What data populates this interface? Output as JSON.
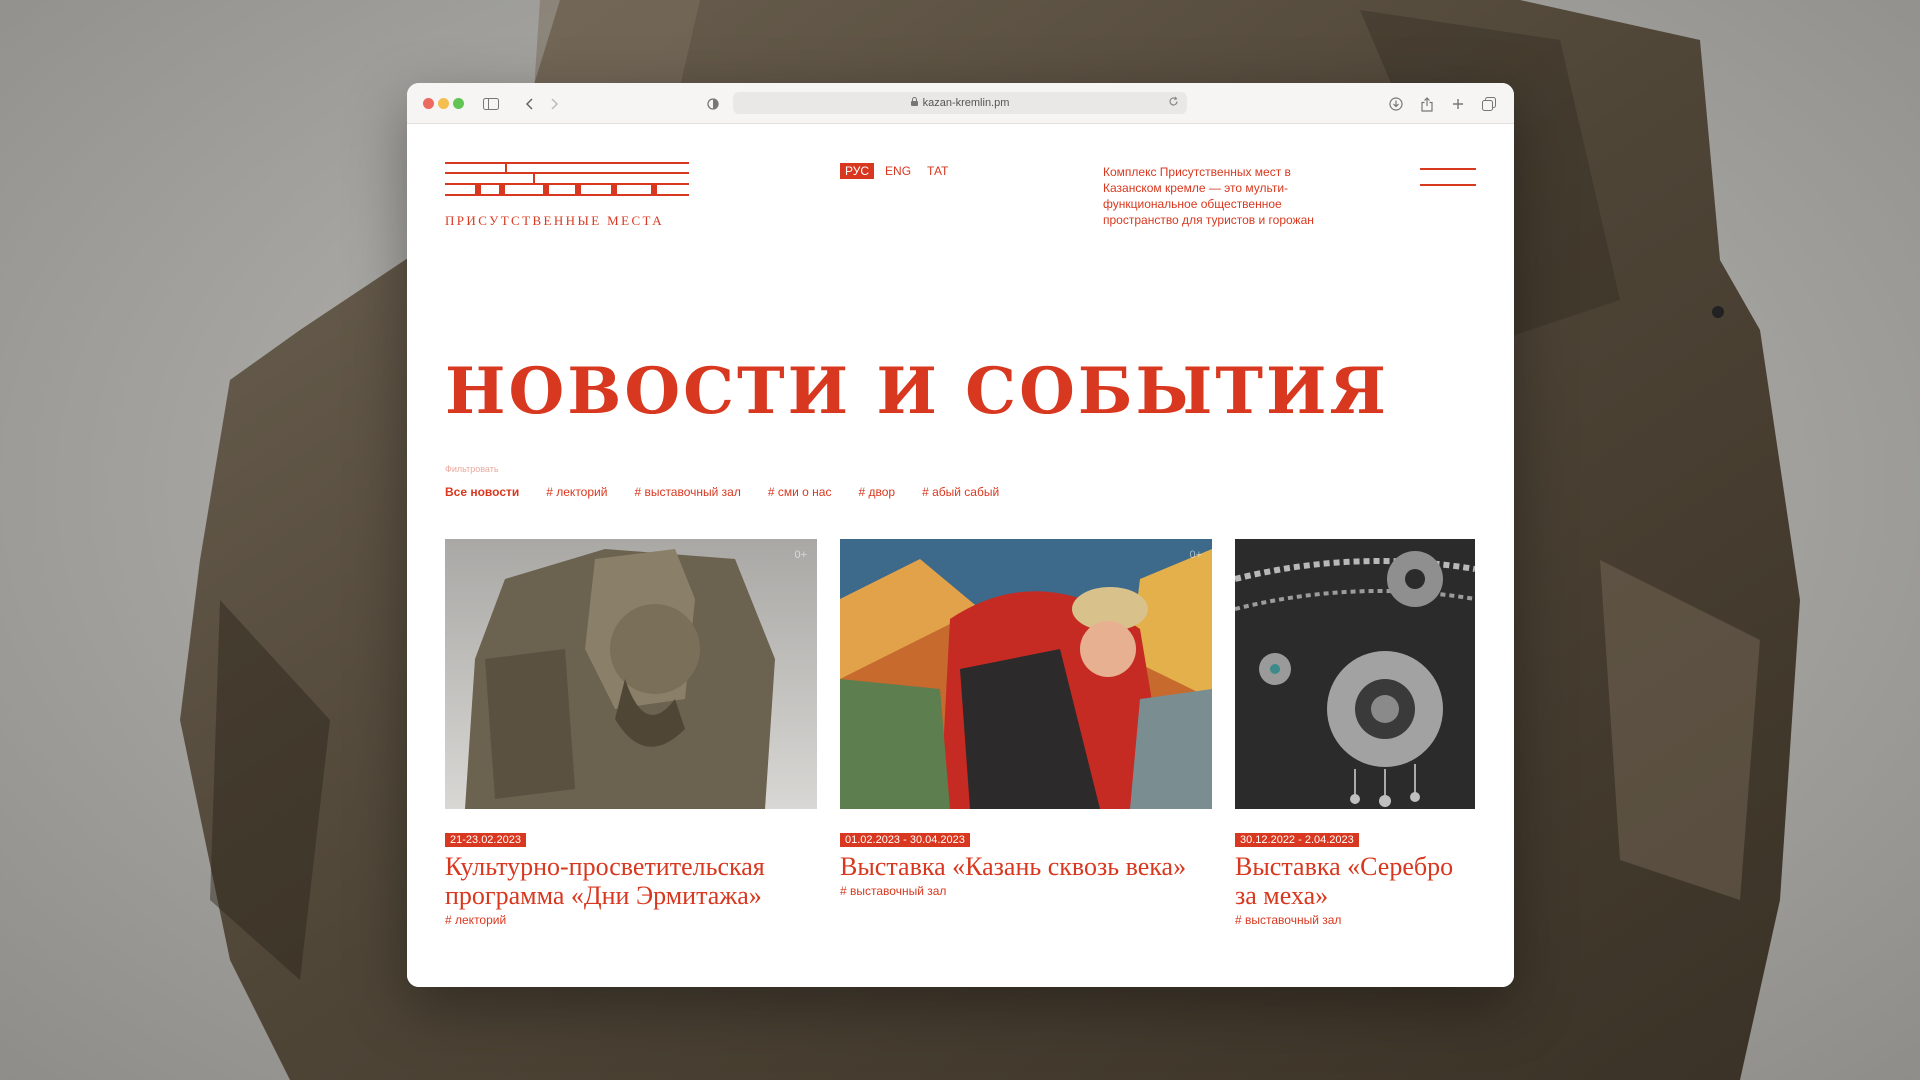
{
  "browser": {
    "url": "kazan-kremlin.pm"
  },
  "site": {
    "logo_text": "Присутственные места",
    "languages": [
      "РУС",
      "ENG",
      "ТАТ"
    ],
    "active_language": "РУС",
    "about": "Комплекс Присутственных мест в Казанском кремле — это мульти-функциональное общественное пространство для туристов и горожан"
  },
  "main": {
    "title": "НОВОСТИ И СОБЫТИЯ",
    "filter_label": "Фильтровать",
    "filters": [
      "Все новости",
      "# лекторий",
      "# выставочный зал",
      "# сми о нас",
      "# двор",
      "# абый сабый"
    ],
    "cards": [
      {
        "age": "0+",
        "date": "21-23.02.2023",
        "title": "Культурно-просветительская программа «Дни Эрмитажа»",
        "tag": "# лекторий"
      },
      {
        "age": "0+",
        "date": "01.02.2023 - 30.04.2023",
        "title": "Выставка «Казань сквозь века»",
        "tag": "# выставочный зал"
      },
      {
        "date": "30.12.2022 - 2.04.2023",
        "title": "Выставка «Серебро за меха»",
        "tag": "# выставочный зал"
      }
    ]
  },
  "colors": {
    "accent": "#d8381f",
    "page_bg": "#ffffff",
    "toolbar_bg": "#f6f5f4"
  }
}
